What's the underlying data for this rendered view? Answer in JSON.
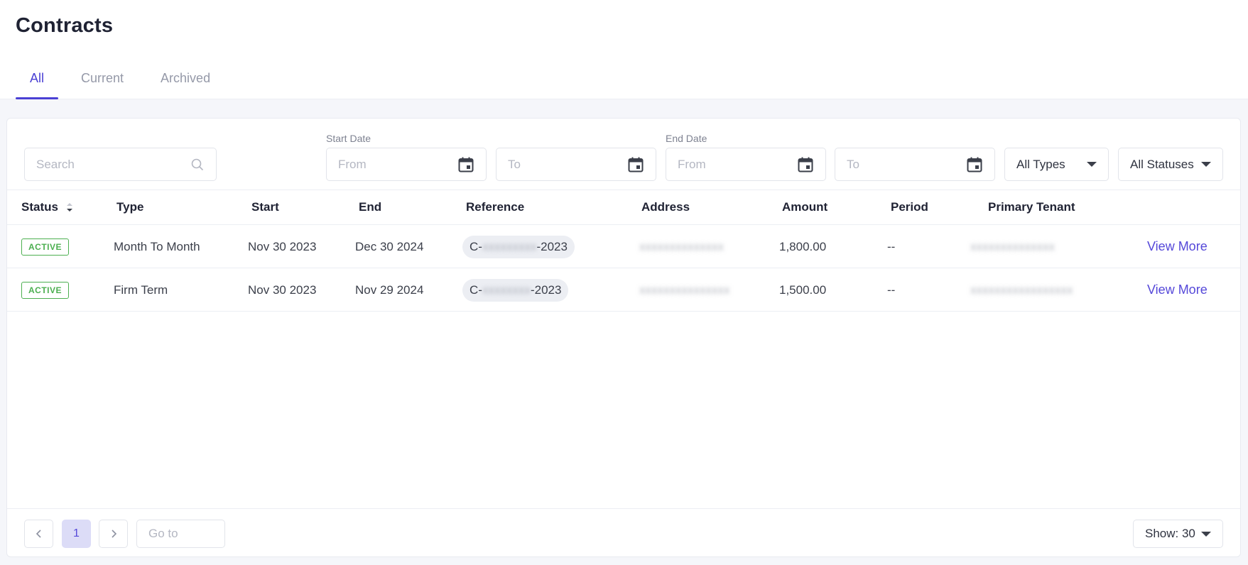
{
  "page": {
    "title": "Contracts"
  },
  "tabs": [
    {
      "label": "All",
      "active": true
    },
    {
      "label": "Current",
      "active": false
    },
    {
      "label": "Archived",
      "active": false
    }
  ],
  "filters": {
    "search_placeholder": "Search",
    "start_date_label": "Start Date",
    "end_date_label": "End Date",
    "from_placeholder": "From",
    "to_placeholder": "To",
    "type_select": "All Types",
    "status_select": "All Statuses"
  },
  "table": {
    "columns": [
      "Status",
      "Type",
      "Start",
      "End",
      "Reference",
      "Address",
      "Amount",
      "Period",
      "Primary Tenant"
    ],
    "rows": [
      {
        "status": "ACTIVE",
        "type": "Month To Month",
        "start": "Nov 30 2023",
        "end": "Dec 30 2024",
        "reference_prefix": "C-",
        "reference_suffix": "-2023",
        "amount": "1,800.00",
        "period": "--",
        "action": "View More"
      },
      {
        "status": "ACTIVE",
        "type": "Firm Term",
        "start": "Nov 30 2023",
        "end": "Nov 29 2024",
        "reference_prefix": "C-",
        "reference_suffix": "-2023",
        "amount": "1,500.00",
        "period": "--",
        "action": "View More"
      }
    ]
  },
  "pagination": {
    "current_page": "1",
    "goto_placeholder": "Go to",
    "page_size": "Show: 30"
  },
  "colors": {
    "accent": "#4a40d4",
    "active_badge": "#4caf50",
    "link": "#5548d9"
  }
}
